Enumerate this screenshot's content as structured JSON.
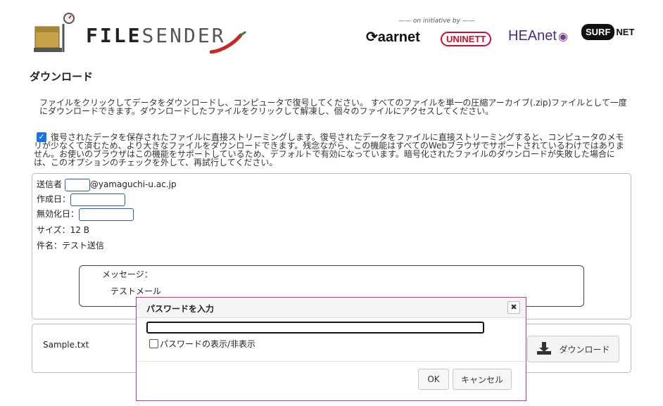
{
  "header": {
    "logo_text_bold": "FILE",
    "logo_text_thin": "SENDER",
    "initiative": "—— on initiative by ——",
    "partners": {
      "aarnet": "aarnet",
      "uninett": "UNINETT",
      "heanet": "HEAnet",
      "surf": "SURF",
      "net": "NET"
    }
  },
  "page": {
    "title": "ダウンロード",
    "description": "ファイルをクリックしてデータをダウンロードし、コンピュータで復号してください。 すべてのファイルを単一の圧縮アーカイブ(.zip)ファイルとして一度にダウンロードできます。ダウンロードしたファイルをクリックして解凍し、個々のファイルにアクセスしてください。",
    "stream_checked": true,
    "stream_text": "復号されたデータを保存されたファイルに直接ストリーミングします。復号されたデータをファイルに直接ストリーミングすると、コンピュータのメモリが少なくて済むため、より大きなファイルをダウンロードできます。残念ながら、この機能はすべてのWebブラウザでサポートされているわけではありません。お使いのブラウザはこの機能をサポートしているため、デフォルトで有効になっています。暗号化されたファイルのダウンロードが失敗した場合には、このオプションのチェックを外して、再試行してください。"
  },
  "transfer": {
    "sender_label": "送信者",
    "sender_domain": "@yamaguchi-u.ac.jp",
    "created_label": "作成日：",
    "expires_label": "無効化日：",
    "size_label": "サイズ：12 B",
    "subject_label": "件名：テスト送信",
    "message_label": "メッセージ：",
    "message_text": "テストメール"
  },
  "file": {
    "name": "Sample.txt",
    "download_label": "ダウンロード"
  },
  "dialog": {
    "title": "パスワードを入力",
    "close": "✖",
    "show_password_label": "パスワードの表示/非表示",
    "ok_label": "OK",
    "cancel_label": "キャンセル",
    "border_color": "#d63384"
  }
}
